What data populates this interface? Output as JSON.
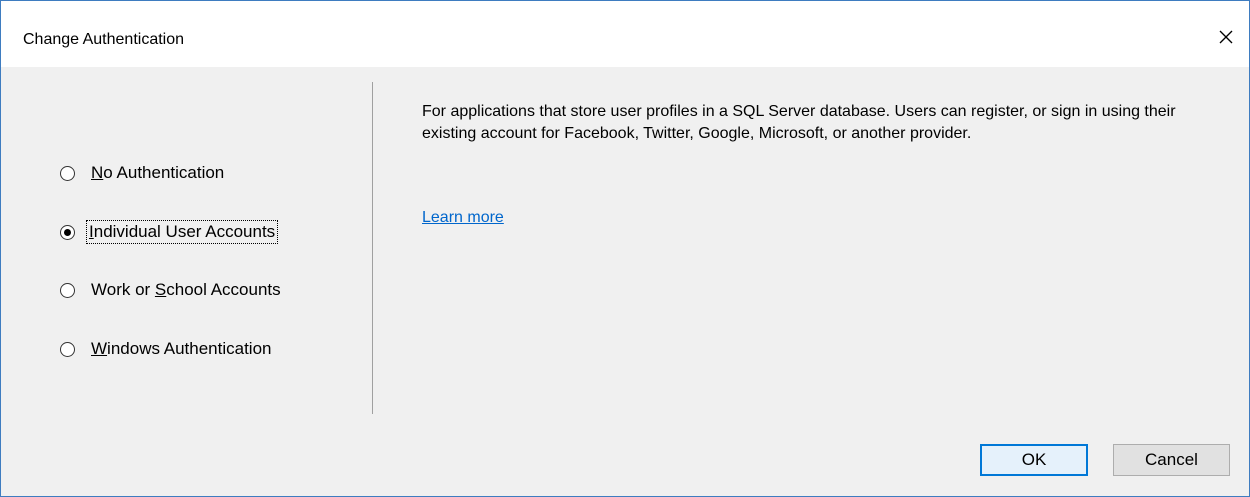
{
  "dialog": {
    "title": "Change Authentication",
    "close_icon": "close-icon"
  },
  "auth_options": [
    {
      "pre": "",
      "mnemonic": "N",
      "post": "o Authentication",
      "selected": false
    },
    {
      "pre": "",
      "mnemonic": "I",
      "post": "ndividual User Accounts",
      "selected": true
    },
    {
      "pre": "Work or ",
      "mnemonic": "S",
      "post": "chool Accounts",
      "selected": false
    },
    {
      "pre": "",
      "mnemonic": "W",
      "post": "indows Authentication",
      "selected": false
    }
  ],
  "description": {
    "text": "For applications that store user profiles in a SQL Server database. Users can register, or sign in using their existing account for Facebook, Twitter, Google, Microsoft, or another provider.",
    "learn_more": "Learn more"
  },
  "buttons": {
    "ok": "OK",
    "cancel": "Cancel"
  },
  "colors": {
    "link": "#0066cc",
    "ok_border": "#0078d7",
    "window_border": "#3e7cc0"
  }
}
